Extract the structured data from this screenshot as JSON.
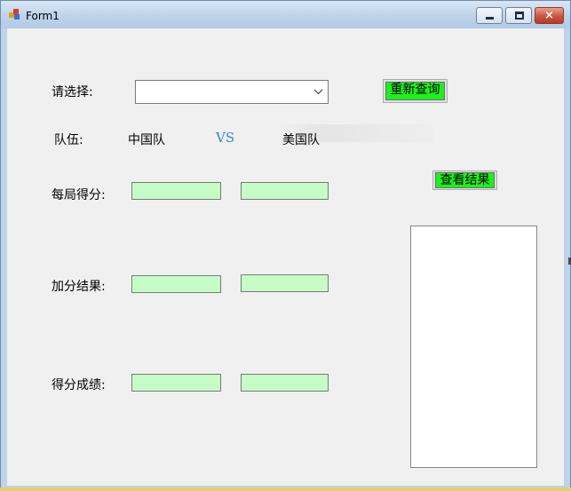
{
  "window": {
    "title": "Form1",
    "controls": {
      "minimize": "minimize",
      "maximize": "maximize",
      "close": "×"
    }
  },
  "selection": {
    "label": "请选择:",
    "combo_value": "",
    "query_button": "重新查询"
  },
  "teams": {
    "label": "队伍:",
    "team_a": "中国队",
    "versus": "VS",
    "team_b": "美国队"
  },
  "result_button": "查看结果",
  "rows": [
    {
      "label": "每局得分:",
      "team_a_value": "",
      "team_b_value": ""
    },
    {
      "label": "加分结果:",
      "team_a_value": "",
      "team_b_value": ""
    },
    {
      "label": "得分成绩:",
      "team_a_value": "",
      "team_b_value": ""
    }
  ],
  "result_output": "",
  "colors": {
    "button_green": "#1fef1f",
    "textbox_green": "#c6fdc6",
    "vs_blue": "#3a86c8",
    "form_background": "#f0f0f0"
  }
}
